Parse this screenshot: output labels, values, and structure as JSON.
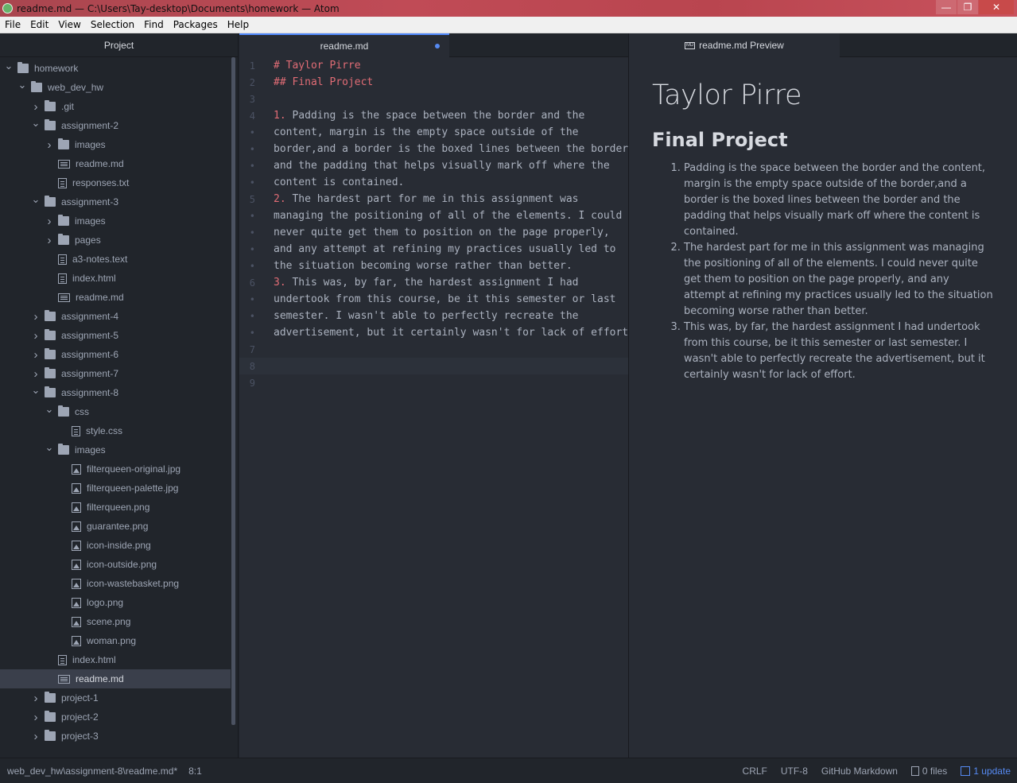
{
  "window": {
    "title": "readme.md — C:\\Users\\Tay-desktop\\Documents\\homework — Atom"
  },
  "menu": [
    "File",
    "Edit",
    "View",
    "Selection",
    "Find",
    "Packages",
    "Help"
  ],
  "tree": {
    "header": "Project",
    "items": [
      {
        "label": "homework",
        "type": "folder",
        "depth": 0,
        "expanded": true
      },
      {
        "label": "web_dev_hw",
        "type": "folder",
        "depth": 1,
        "expanded": true
      },
      {
        "label": ".git",
        "type": "folder",
        "depth": 2,
        "expanded": false
      },
      {
        "label": "assignment-2",
        "type": "folder",
        "depth": 2,
        "expanded": true
      },
      {
        "label": "images",
        "type": "folder",
        "depth": 3,
        "expanded": false
      },
      {
        "label": "readme.md",
        "type": "md",
        "depth": 3
      },
      {
        "label": "responses.txt",
        "type": "file",
        "depth": 3
      },
      {
        "label": "assignment-3",
        "type": "folder",
        "depth": 2,
        "expanded": true
      },
      {
        "label": "images",
        "type": "folder",
        "depth": 3,
        "expanded": false
      },
      {
        "label": "pages",
        "type": "folder",
        "depth": 3,
        "expanded": false
      },
      {
        "label": "a3-notes.text",
        "type": "file",
        "depth": 3
      },
      {
        "label": "index.html",
        "type": "file",
        "depth": 3
      },
      {
        "label": "readme.md",
        "type": "md",
        "depth": 3
      },
      {
        "label": "assignment-4",
        "type": "folder",
        "depth": 2,
        "expanded": false
      },
      {
        "label": "assignment-5",
        "type": "folder",
        "depth": 2,
        "expanded": false
      },
      {
        "label": "assignment-6",
        "type": "folder",
        "depth": 2,
        "expanded": false
      },
      {
        "label": "assignment-7",
        "type": "folder",
        "depth": 2,
        "expanded": false
      },
      {
        "label": "assignment-8",
        "type": "folder",
        "depth": 2,
        "expanded": true
      },
      {
        "label": "css",
        "type": "folder",
        "depth": 3,
        "expanded": true
      },
      {
        "label": "style.css",
        "type": "file",
        "depth": 4
      },
      {
        "label": "images",
        "type": "folder",
        "depth": 3,
        "expanded": true
      },
      {
        "label": "filterqueen-original.jpg",
        "type": "img",
        "depth": 4
      },
      {
        "label": "filterqueen-palette.jpg",
        "type": "img",
        "depth": 4
      },
      {
        "label": "filterqueen.png",
        "type": "img",
        "depth": 4
      },
      {
        "label": "guarantee.png",
        "type": "img",
        "depth": 4
      },
      {
        "label": "icon-inside.png",
        "type": "img",
        "depth": 4
      },
      {
        "label": "icon-outside.png",
        "type": "img",
        "depth": 4
      },
      {
        "label": "icon-wastebasket.png",
        "type": "img",
        "depth": 4
      },
      {
        "label": "logo.png",
        "type": "img",
        "depth": 4
      },
      {
        "label": "scene.png",
        "type": "img",
        "depth": 4
      },
      {
        "label": "woman.png",
        "type": "img",
        "depth": 4
      },
      {
        "label": "index.html",
        "type": "file",
        "depth": 3
      },
      {
        "label": "readme.md",
        "type": "md",
        "depth": 3,
        "selected": true
      },
      {
        "label": "project-1",
        "type": "folder",
        "depth": 2,
        "expanded": false
      },
      {
        "label": "project-2",
        "type": "folder",
        "depth": 2,
        "expanded": false
      },
      {
        "label": "project-3",
        "type": "folder",
        "depth": 2,
        "expanded": false
      }
    ]
  },
  "editor": {
    "tab_label": "readme.md",
    "lines": [
      {
        "gutter": "1",
        "text": "# Taylor Pirre",
        "style": "hd"
      },
      {
        "gutter": "2",
        "text": "## Final Project",
        "style": "hd"
      },
      {
        "gutter": "3",
        "text": ""
      },
      {
        "gutter": "4",
        "num": "1.",
        "text": " Padding is the space between the border and the"
      },
      {
        "gutter": "•",
        "text": "content, margin is the empty space outside of the"
      },
      {
        "gutter": "•",
        "text": "border,and a border is the boxed lines between the border"
      },
      {
        "gutter": "•",
        "text": "and the padding that helps visually mark off where the"
      },
      {
        "gutter": "•",
        "text": "content is contained."
      },
      {
        "gutter": "5",
        "num": "2.",
        "text": " The hardest part for me in this assignment was"
      },
      {
        "gutter": "•",
        "text": "managing the positioning of all of the elements. I could"
      },
      {
        "gutter": "•",
        "text": "never quite get them to position on the page properly,"
      },
      {
        "gutter": "•",
        "text": "and any attempt at refining my practices usually led to"
      },
      {
        "gutter": "•",
        "text": "the situation becoming worse rather than better."
      },
      {
        "gutter": "6",
        "num": "3.",
        "text": " This was, by far, the hardest assignment I had"
      },
      {
        "gutter": "•",
        "text": "undertook from this course, be it this semester or last"
      },
      {
        "gutter": "•",
        "text": "semester. I wasn't able to perfectly recreate the"
      },
      {
        "gutter": "•",
        "text": "advertisement, but it certainly wasn't for lack of effort."
      },
      {
        "gutter": "7",
        "text": ""
      },
      {
        "gutter": "8",
        "text": "",
        "cursor": true
      },
      {
        "gutter": "9",
        "text": ""
      }
    ]
  },
  "preview": {
    "tab_label": "readme.md Preview",
    "md_badge": "MD",
    "h1": "Taylor Pirre",
    "h2": "Final Project",
    "items": [
      "Padding is the space between the border and the content, margin is the empty space outside of the border,and a border is the boxed lines between the border and the padding that helps visually mark off where the content is contained.",
      "The hardest part for me in this assignment was managing the positioning of all of the elements. I could never quite get them to position on the page properly, and any attempt at refining my practices usually led to the situation becoming worse rather than better.",
      "This was, by far, the hardest assignment I had undertook from this course, be it this semester or last semester. I wasn't able to perfectly recreate the advertisement, but it certainly wasn't for lack of effort."
    ]
  },
  "status": {
    "path": "web_dev_hw\\assignment-8\\readme.md*",
    "cursor": "8:1",
    "line_ending": "CRLF",
    "encoding": "UTF-8",
    "grammar": "GitHub Markdown",
    "files": "0 files",
    "update": "1 update"
  }
}
